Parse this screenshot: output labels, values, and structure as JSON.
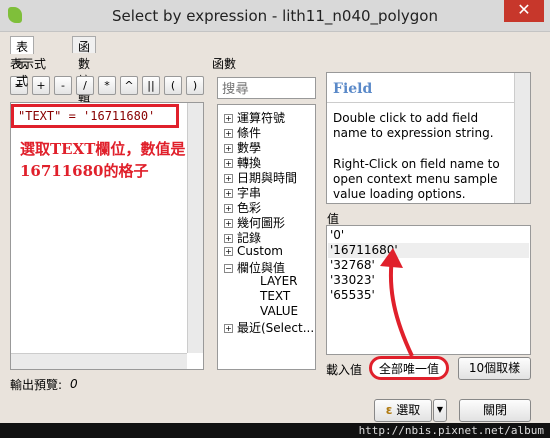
{
  "window": {
    "title": "Select by expression - lith11_n040_polygon",
    "close_glyph": "✕"
  },
  "tabs": [
    {
      "label": "表示式"
    },
    {
      "label": "函數編輯器"
    }
  ],
  "section": {
    "expression_label": "表示式",
    "function_label": "函數"
  },
  "operators": [
    "=",
    "+",
    "-",
    "/",
    "*",
    "^",
    "||",
    "(",
    ")"
  ],
  "expression": {
    "value": "\"TEXT\" = '16711680'"
  },
  "annotation": {
    "line1": "選取TEXT欄位，數值是",
    "line2": "16711680的格子"
  },
  "search": {
    "placeholder": "搜尋"
  },
  "tree": {
    "items": [
      "運算符號",
      "條件",
      "數學",
      "轉換",
      "日期與時間",
      "字串",
      "色彩",
      "幾何圖形",
      "記錄",
      "Custom",
      "欄位與值"
    ],
    "children": [
      "LAYER",
      "TEXT",
      "VALUE"
    ],
    "last": "最近(Select..."
  },
  "help": {
    "title": "Field",
    "p1": "Double click to add field name to expression string.",
    "p2": "Right-Click on field name to open context menu sample value loading options."
  },
  "values": {
    "label": "值",
    "items": [
      "'0'",
      "'16711680'",
      "'32768'",
      "'33023'",
      "'65535'"
    ]
  },
  "load": {
    "label": "載入值",
    "all_unique": "全部唯一值",
    "ten_samples": "10個取樣"
  },
  "output": {
    "label": "輸出預覽:",
    "value": "0"
  },
  "buttons": {
    "select": "選取",
    "close": "關閉"
  },
  "watermark": "http://nbis.pixnet.net/album"
}
